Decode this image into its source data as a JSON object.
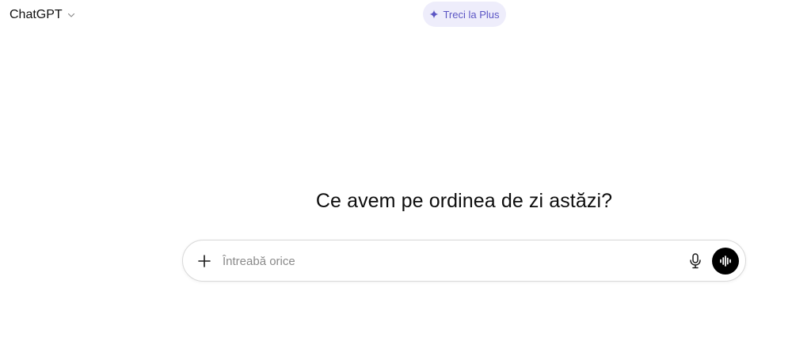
{
  "header": {
    "model_label": "ChatGPT",
    "upgrade_label": "Treci la Plus"
  },
  "main": {
    "greeting": "Ce avem pe ordinea de zi astăzi?"
  },
  "composer": {
    "placeholder": "Întreabă orice",
    "value": ""
  },
  "icons": {
    "model_dropdown": "chevron-down-icon",
    "upgrade": "sparkle-icon",
    "attach": "plus-icon",
    "dictate": "microphone-icon",
    "voice": "waveform-icon"
  },
  "colors": {
    "upgrade_bg": "#eeedfb",
    "upgrade_text": "#5b55c4",
    "voice_button": "#000000"
  }
}
